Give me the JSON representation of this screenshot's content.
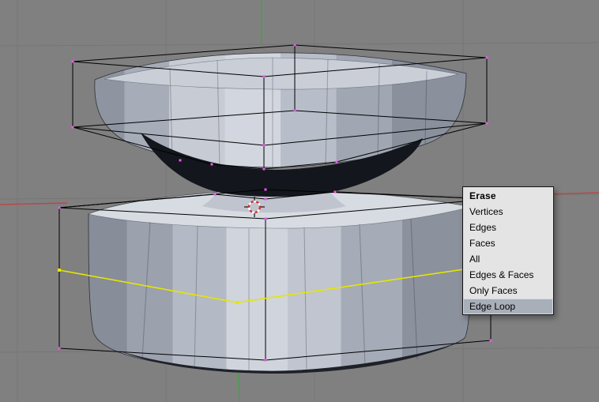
{
  "viewport": {
    "background_color": "#808080",
    "grid_color": "#767676",
    "x_axis_color": "#b84848",
    "y_axis_color": "#44a044",
    "wireframe_color": "#000000",
    "vertex_color": "#f055f0",
    "selected_edge_color": "#e6e600",
    "mesh_colors": {
      "top_light": "#c9ced7",
      "side_mid": "#aab0bb",
      "underside_dark": "#13161c",
      "bottom_cap": "#d7dbe2"
    },
    "cursor_colors": {
      "ring_red": "#cc3333",
      "ring_white": "#ffffff",
      "tick_black": "#111111"
    }
  },
  "menu": {
    "title": "Erase",
    "highlighted_label": "Edge Loop",
    "items": [
      {
        "label": "Vertices",
        "highlighted": false
      },
      {
        "label": "Edges",
        "highlighted": false
      },
      {
        "label": "Faces",
        "highlighted": false
      },
      {
        "label": "All",
        "highlighted": false
      },
      {
        "label": "Edges & Faces",
        "highlighted": false
      },
      {
        "label": "Only Faces",
        "highlighted": false
      },
      {
        "label": "Edge Loop",
        "highlighted": true
      }
    ],
    "colors": {
      "background": "#e4e4e4",
      "text": "#000000",
      "highlight_background": "#a9afb9",
      "border": "#141414"
    }
  }
}
